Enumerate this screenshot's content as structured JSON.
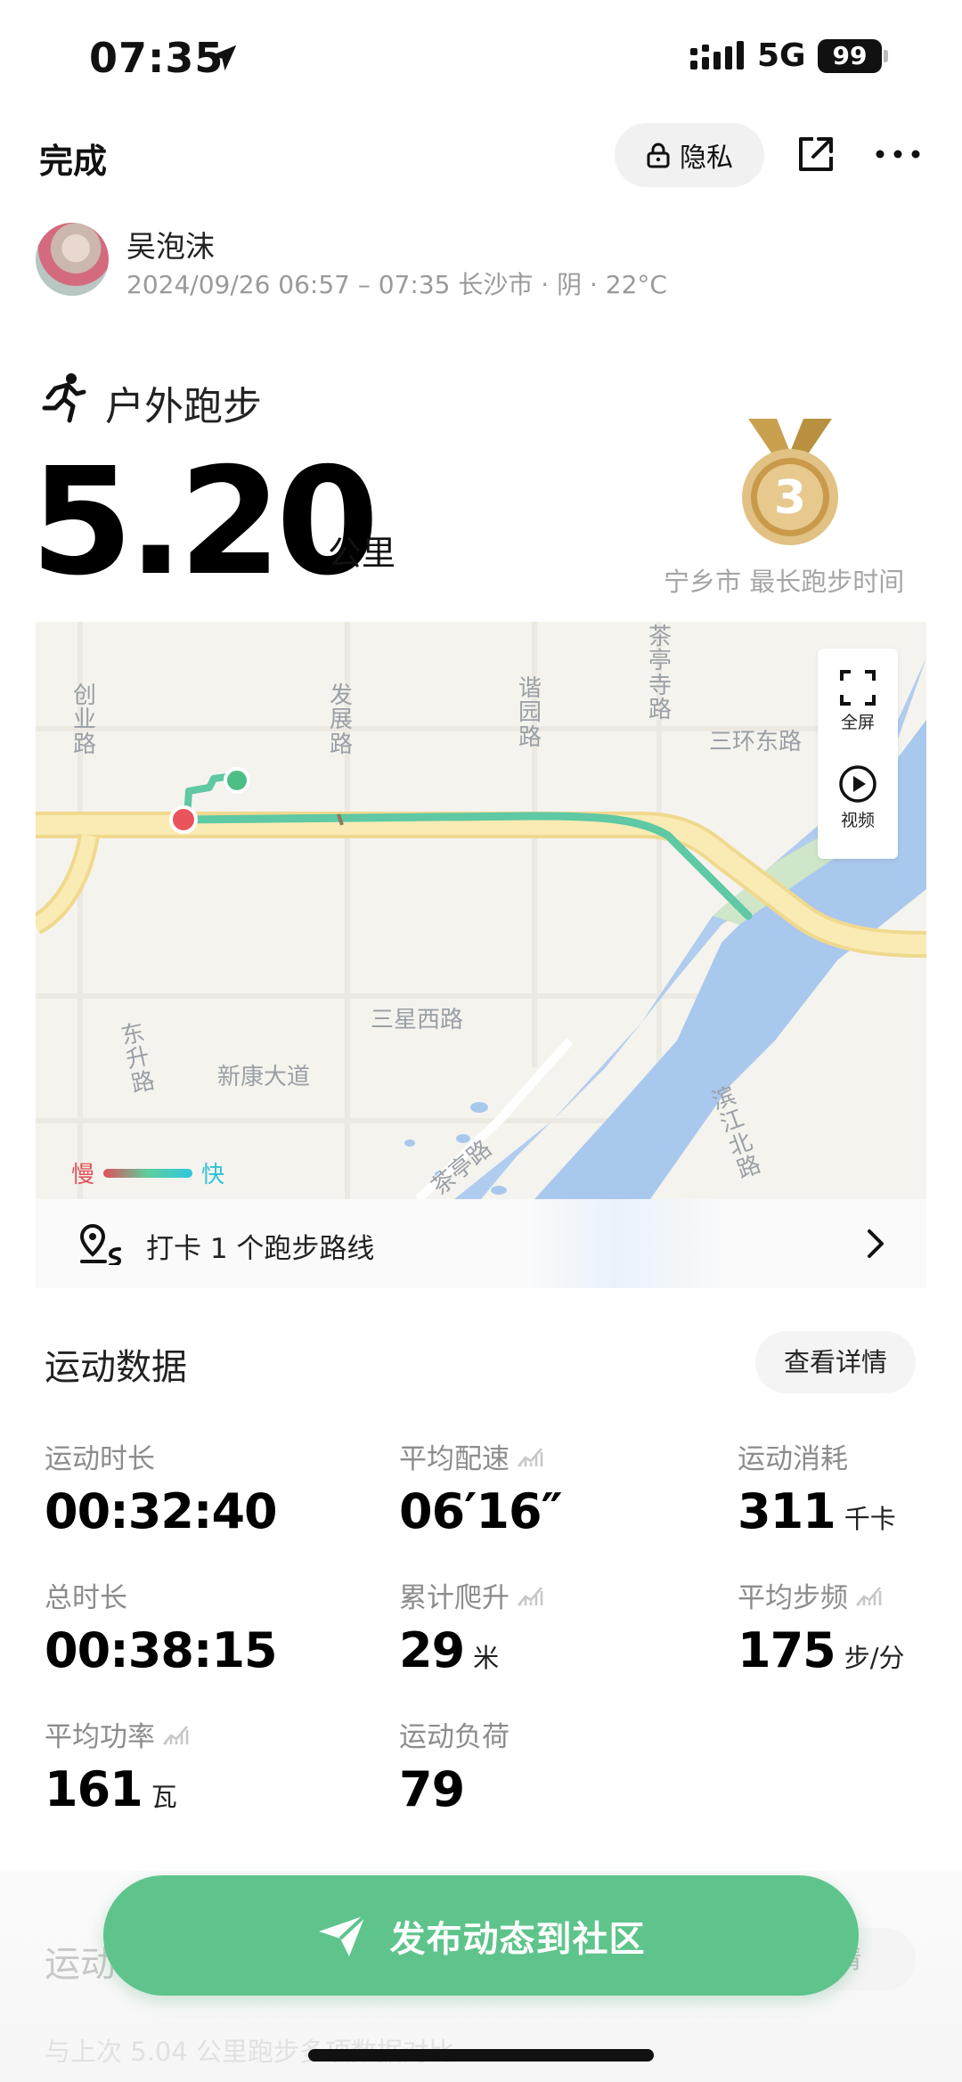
{
  "status_bar": {
    "time": "07:35",
    "network": "5G",
    "battery": "99"
  },
  "header": {
    "done_label": "完成",
    "privacy_label": "隐私"
  },
  "user": {
    "name": "吴泡沫",
    "meta": "2024/09/26 06:57 – 07:35 长沙市 · 阴 · 22°C"
  },
  "activity": {
    "type": "户外跑步",
    "distance": "5.20",
    "distance_unit": "公里",
    "medal_number": "3",
    "medal_caption": "宁乡市 最长跑步时间"
  },
  "map": {
    "labels": {
      "chuangye": "创业路",
      "fazhan": "发展路",
      "xieyuan": "谐园路",
      "chating": "茶亭寺路",
      "sanhuan": "三环东路",
      "sanxing": "三星西路",
      "dongsheng": "东升路",
      "xinkang": "新康大道",
      "binjiang": "滨江北路",
      "chatinglu": "茶亭路"
    },
    "fullscreen_label": "全屏",
    "video_label": "视频",
    "legend_slow": "慢",
    "legend_fast": "快",
    "colors": {
      "water": "#a9c8ee",
      "road": "#f7e7a4",
      "route_start": "#e9545d",
      "route_end": "#4dbf86",
      "route": "#5ec9a4"
    }
  },
  "route_card": {
    "text": "打卡 1 个跑步路线"
  },
  "sport_data": {
    "title": "运动数据",
    "details_label": "查看详情",
    "stats": [
      {
        "label": "运动时长",
        "value": "00:32:40",
        "unit": ""
      },
      {
        "label": "平均配速",
        "value": "06′16″",
        "unit": ""
      },
      {
        "label": "运动消耗",
        "value": "311",
        "unit": "千卡"
      },
      {
        "label": "总时长",
        "value": "00:38:15",
        "unit": ""
      },
      {
        "label": "累计爬升",
        "value": "29",
        "unit": "米"
      },
      {
        "label": "平均步频",
        "value": "175",
        "unit": "步/分"
      },
      {
        "label": "平均功率",
        "value": "161",
        "unit": "瓦"
      },
      {
        "label": "运动负荷",
        "value": "79",
        "unit": ""
      }
    ]
  },
  "bottom": {
    "faded_title": "运动",
    "faded_button": "详情",
    "faded_sub": "与上次 5.04 公里跑步多项数据对比",
    "publish_label": "发布动态到社区"
  }
}
